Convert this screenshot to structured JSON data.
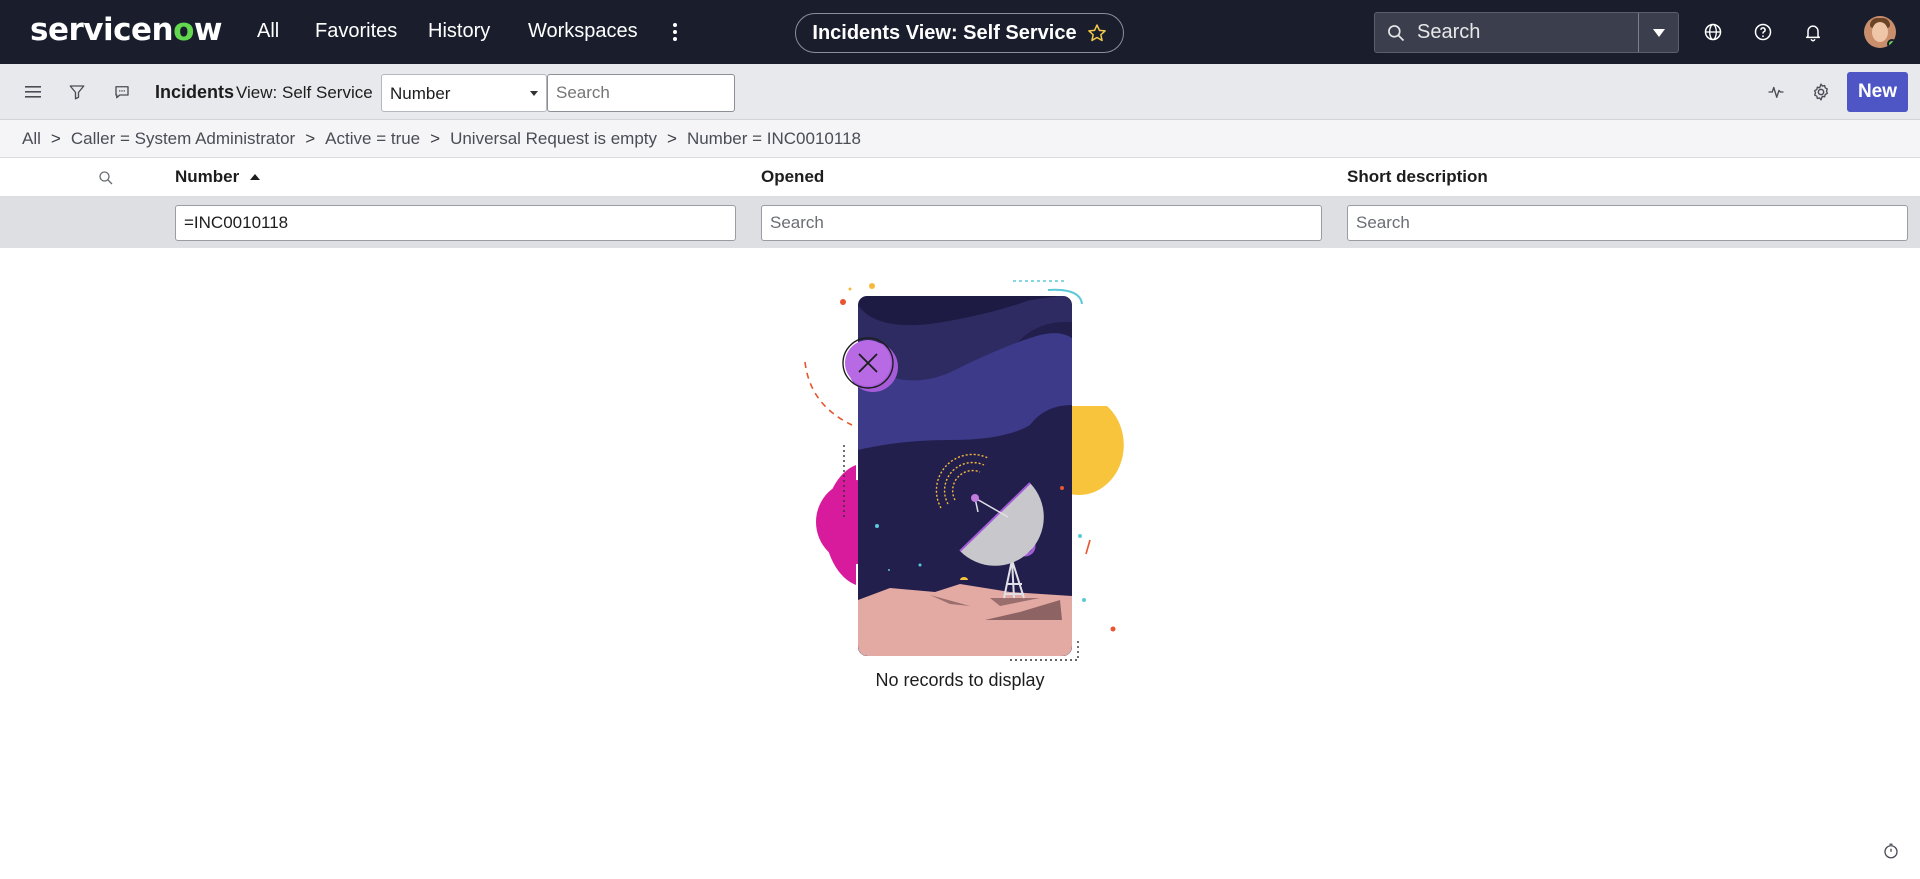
{
  "brand": {
    "name_prefix": "servicen",
    "name_o": "o",
    "name_suffix": "w",
    "accent": "#62d84e",
    "nav_bg": "#1a1e2c"
  },
  "nav": {
    "items": [
      "All",
      "Favorites",
      "History",
      "Workspaces"
    ]
  },
  "context": {
    "title": "Incidents View: Self Service"
  },
  "global_search": {
    "placeholder": "Search"
  },
  "toolbar": {
    "title": "Incidents",
    "view": "View: Self Service",
    "field_select": "Number",
    "search_placeholder": "Search",
    "new_label": "New",
    "button_color": "#4e56c6"
  },
  "breadcrumbs": [
    "All",
    "Caller = System Administrator",
    "Active = true",
    "Universal Request is empty",
    "Number = INC0010118"
  ],
  "columns": [
    {
      "label": "Number",
      "sort": "ascending",
      "filter_value": "=INC0010118"
    },
    {
      "label": "Opened",
      "filter_placeholder": "Search"
    },
    {
      "label": "Short description",
      "filter_placeholder": "Search"
    }
  ],
  "empty_state": {
    "message": "No records to display"
  }
}
